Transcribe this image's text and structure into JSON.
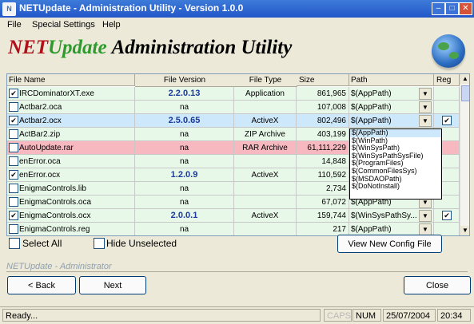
{
  "window": {
    "title": "NETUpdate - Administration Utility - Version 1.0.0"
  },
  "menu": [
    "File",
    "Special Settings",
    "Help"
  ],
  "banner": {
    "part1": "NET",
    "part2": "Update",
    "part3": "Administration Utility"
  },
  "table": {
    "headers": [
      "File Name",
      "File Version",
      "File Type",
      "Size",
      "Path",
      "Reg"
    ],
    "rows": [
      {
        "checked": true,
        "name": "IRCDominatorXT.exe",
        "version": "2.2.0.13",
        "type": "Application",
        "size": "861,965",
        "path": "$(AppPath)",
        "reg": false,
        "style": "light"
      },
      {
        "checked": false,
        "name": "Actbar2.oca",
        "version": "na",
        "type": "",
        "size": "107,008",
        "path": "$(AppPath)",
        "reg": false,
        "style": "light"
      },
      {
        "checked": true,
        "name": "Actbar2.ocx",
        "version": "2.5.0.65",
        "type": "ActiveX",
        "size": "802,496",
        "path": "$(AppPath)",
        "reg": true,
        "style": "sel"
      },
      {
        "checked": false,
        "name": "ActBar2.zip",
        "version": "na",
        "type": "ZIP Archive",
        "size": "403,199",
        "path": "",
        "reg": false,
        "style": "light"
      },
      {
        "checked": false,
        "name": "AutoUpdate.rar",
        "version": "na",
        "type": "RAR Archive",
        "size": "61,111,229",
        "path": "",
        "reg": false,
        "style": "pink"
      },
      {
        "checked": false,
        "name": "enError.oca",
        "version": "na",
        "type": "",
        "size": "14,848",
        "path": "",
        "reg": false,
        "style": "light"
      },
      {
        "checked": true,
        "name": "enError.ocx",
        "version": "1.2.0.9",
        "type": "ActiveX",
        "size": "110,592",
        "path": "",
        "reg": false,
        "style": "light"
      },
      {
        "checked": false,
        "name": "EnigmaControls.lib",
        "version": "na",
        "type": "",
        "size": "2,734",
        "path": "",
        "reg": false,
        "style": "light"
      },
      {
        "checked": false,
        "name": "EnigmaControls.oca",
        "version": "na",
        "type": "",
        "size": "67,072",
        "path": "$(AppPath)",
        "reg": false,
        "style": "light"
      },
      {
        "checked": true,
        "name": "EnigmaControls.ocx",
        "version": "2.0.0.1",
        "type": "ActiveX",
        "size": "159,744",
        "path": "$(WinSysPathSy...",
        "reg": true,
        "style": "light"
      },
      {
        "checked": false,
        "name": "EnigmaControls.reg",
        "version": "na",
        "type": "",
        "size": "217",
        "path": "$(AppPath)",
        "reg": false,
        "style": "light"
      }
    ]
  },
  "path_dropdown": {
    "options": [
      "$(AppPath)",
      "$(WinPath)",
      "$(WinSysPath)",
      "$(WinSysPathSysFile)",
      "$(ProgramFiles)",
      "$(CommonFilesSys)",
      "$(MSDAOPath)",
      "$(DoNotInstall)"
    ],
    "selected": "$(AppPath)"
  },
  "controls": {
    "select_all": "Select All",
    "hide_unselected": "Hide Unselected",
    "view_config": "View New Config File"
  },
  "separator_label": "NETUpdate - Administrator",
  "nav": {
    "back": "< Back",
    "next": "Next",
    "close": "Close"
  },
  "status": {
    "text": "Ready...",
    "caps": "CAPS",
    "num": "NUM",
    "date": "25/07/2004",
    "time": "20:34"
  },
  "colors": {
    "title_bg": "#2356c8",
    "row_light": "#e8f8e8",
    "row_selected": "#cde8fa",
    "row_pink": "#f8b8c0",
    "version_text": "#1a3a9c"
  }
}
